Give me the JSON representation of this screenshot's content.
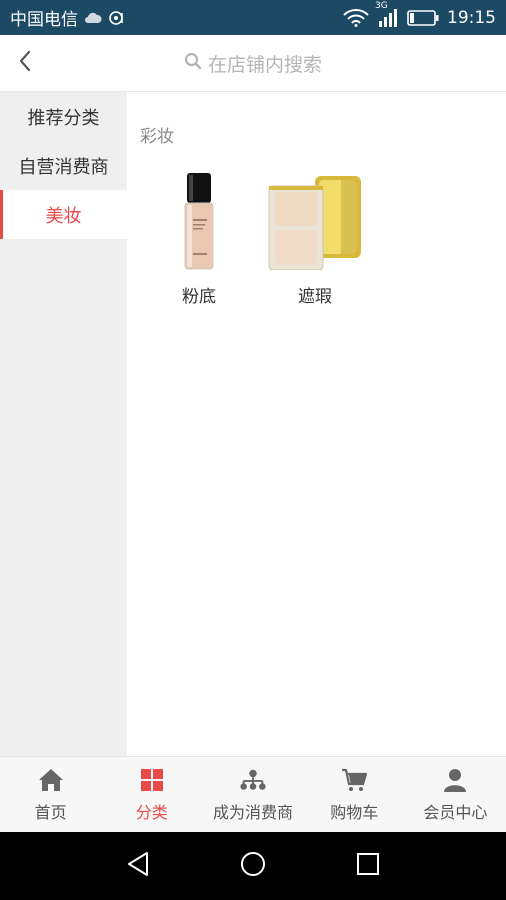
{
  "status_bar": {
    "carrier": "中国电信",
    "network": "3G",
    "time": "19:15",
    "icons": [
      "cloud-icon",
      "hotspot-icon",
      "wifi-icon",
      "signal-icon",
      "battery-icon"
    ]
  },
  "header": {
    "back_icon": "chevron-left-icon",
    "search_placeholder": "在店铺内搜索"
  },
  "sidebar": {
    "items": [
      {
        "label": "推荐分类",
        "active": false
      },
      {
        "label": "自营消费商",
        "active": false
      },
      {
        "label": "美妆",
        "active": true
      }
    ]
  },
  "main": {
    "section_title": "彩妆",
    "products": [
      {
        "name": "粉底",
        "icon": "foundation-bottle-image"
      },
      {
        "name": "遮瑕",
        "icon": "concealer-compact-image"
      }
    ]
  },
  "tabbar": {
    "tabs": [
      {
        "label": "首页",
        "icon": "home-icon",
        "active": false
      },
      {
        "label": "分类",
        "icon": "grid-icon",
        "active": true
      },
      {
        "label": "成为消费商",
        "icon": "network-icon",
        "active": false
      },
      {
        "label": "购物车",
        "icon": "cart-icon",
        "active": false
      },
      {
        "label": "会员中心",
        "icon": "user-icon",
        "active": false
      }
    ]
  },
  "colors": {
    "accent": "#e84a4a",
    "status_bar": "#1c4a64",
    "sidebar_bg": "#efefef",
    "tab_bg": "#f7f7f7"
  }
}
